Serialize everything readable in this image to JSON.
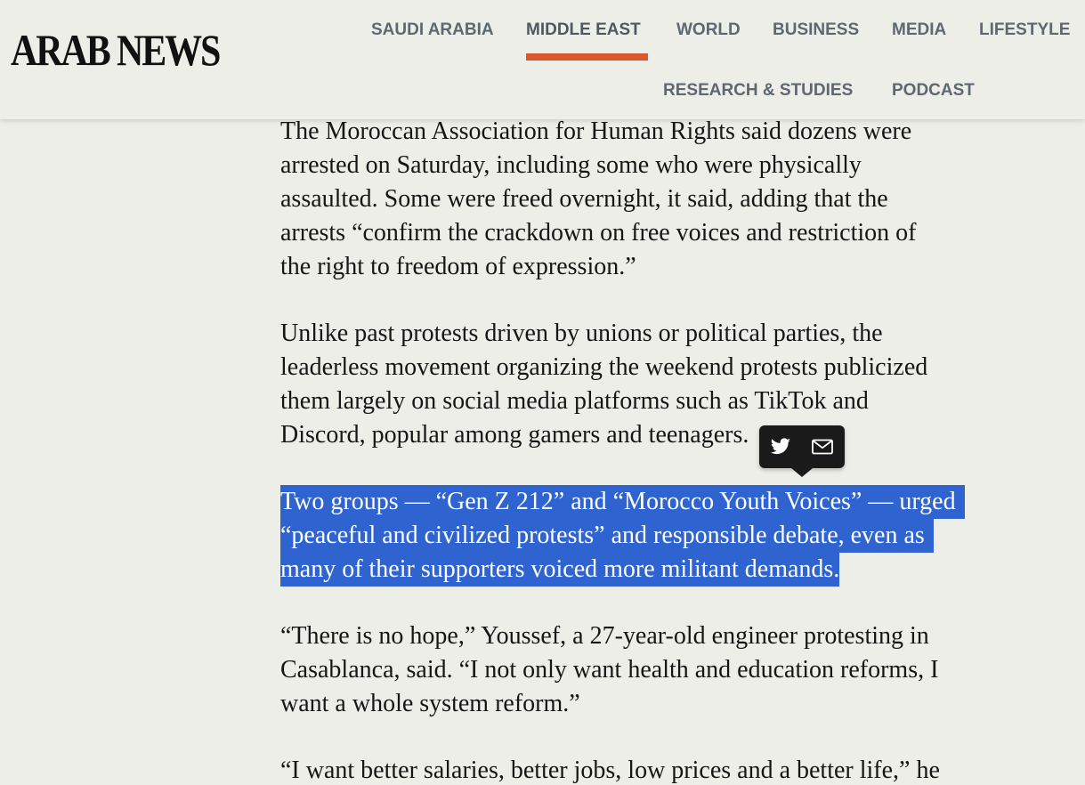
{
  "site": {
    "logo": "ARAB NEWS"
  },
  "nav": {
    "items": [
      {
        "label": "SAUDI ARABIA"
      },
      {
        "label": "MIDDLE EAST"
      },
      {
        "label": "WORLD"
      },
      {
        "label": "BUSINESS"
      },
      {
        "label": "MEDIA"
      },
      {
        "label": "LIFESTYLE"
      },
      {
        "label": "RESEARCH & STUDIES"
      },
      {
        "label": "PODCAST"
      }
    ],
    "active": "MIDDLE EAST",
    "accent_color": "#d9562e"
  },
  "article": {
    "paragraphs": [
      {
        "lines": [
          "The Moroccan Association for Human Rights said dozens were",
          "arrested on Saturday, including some who were physically",
          "assaulted. Some were freed overnight, it said, adding that the",
          "arrests “confirm the crackdown on free voices and restriction of",
          "the right to freedom of expression.”"
        ]
      },
      {
        "lines": [
          "Unlike past protests driven by unions or political parties, the",
          "leaderless movement organizing the weekend protests publicized",
          "them largely on social media platforms such as TikTok and",
          "Discord, popular among gamers and teenagers."
        ]
      },
      {
        "selected": true,
        "lines": [
          "Two groups — “Gen Z 212” and “Morocco Youth Voices” — urged",
          "“peaceful and civilized protests” and responsible debate, even as",
          "many of their supporters voiced more militant demands."
        ]
      },
      {
        "lines": [
          "“There is no hope,” Youssef, a 27-year-old engineer protesting in",
          "Casablanca, said. “I not only want health and education reforms, I",
          "want a whole system reform.”"
        ]
      },
      {
        "lines": [
          "“I want better salaries, better jobs, low prices and a better life,” he"
        ]
      }
    ]
  },
  "share_popup": {
    "buttons": [
      {
        "icon": "twitter-icon"
      },
      {
        "icon": "mail-icon"
      }
    ],
    "background": "#1a1a1a"
  },
  "selection_color": "#2f64d0"
}
